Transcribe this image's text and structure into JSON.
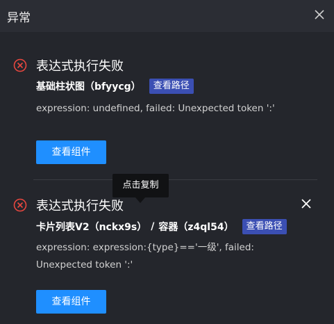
{
  "header": {
    "title": "异常"
  },
  "errors": [
    {
      "title": "表达式执行失败",
      "component": "基础柱状图（bfyycg）",
      "path_button": "查看路径",
      "message": "expression: undefined, failed: Unexpected token ':'",
      "view_button": "查看组件"
    },
    {
      "title": "表达式执行失败",
      "component": "卡片列表V2（nckx9s）",
      "separator": "/",
      "container": "容器（z4ql54）",
      "path_button": "查看路径",
      "message_line1": "expression: expression:{type}=='一级', failed:",
      "message_line2": "Unexpected token ':'",
      "view_button": "查看组件"
    }
  ],
  "tooltip": {
    "text": "点击复制"
  },
  "colors": {
    "error_icon": "#e8473f",
    "primary_button": "#1f8fff",
    "path_button": "#3b4fb3"
  }
}
